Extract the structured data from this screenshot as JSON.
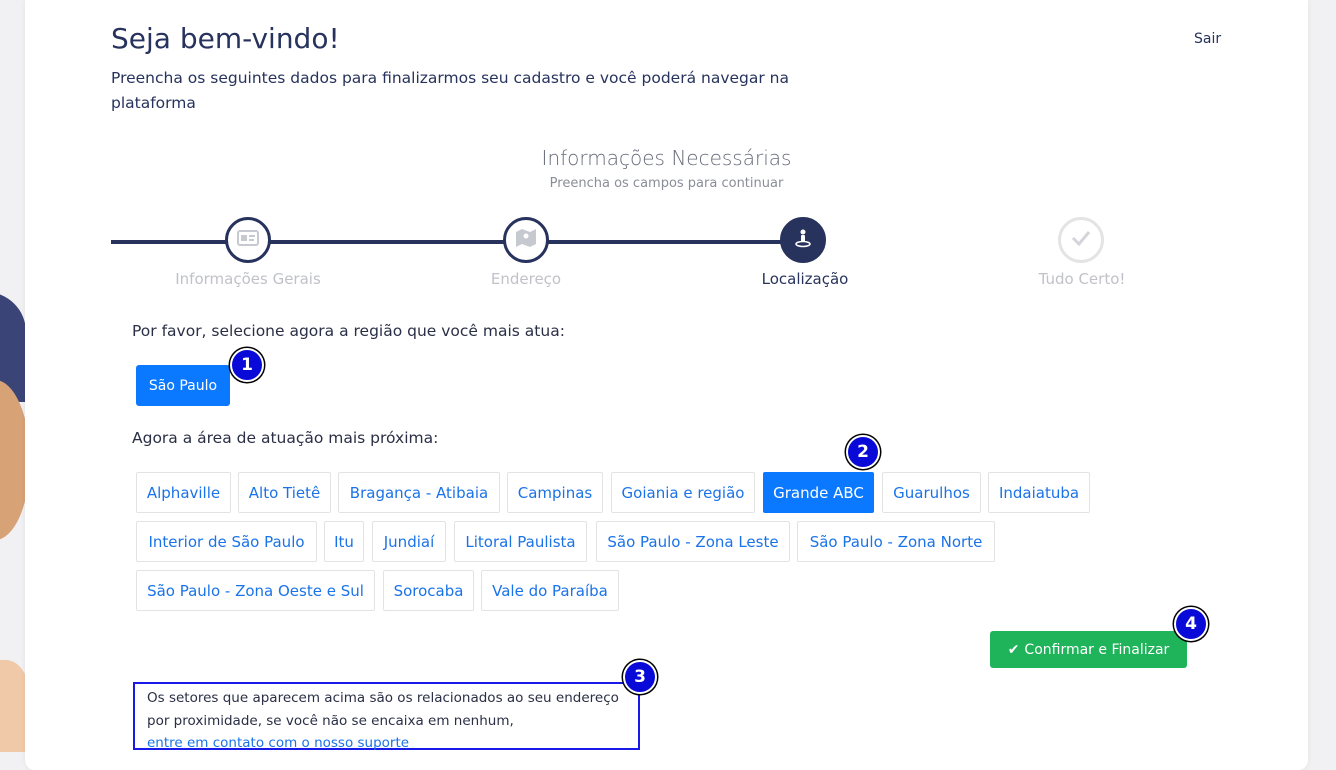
{
  "header": {
    "title": "Seja bem-vindo!",
    "subtitle": "Preencha os seguintes dados para finalizarmos seu cadastro e você poderá navegar na plataforma",
    "logout_label": "Sair"
  },
  "info": {
    "heading": "Informações Necessárias",
    "subheading": "Preencha os campos para continuar"
  },
  "steps": [
    {
      "label": "Informações Gerais",
      "icon": "id-card-icon",
      "state": "done"
    },
    {
      "label": "Endereço",
      "icon": "map-icon",
      "state": "done"
    },
    {
      "label": "Localização",
      "icon": "location-person-icon",
      "state": "active"
    },
    {
      "label": "Tudo Certo!",
      "icon": "check-icon",
      "state": "pending"
    }
  ],
  "region": {
    "question": "Por favor, selecione agora a região que você mais atua:",
    "options": [
      "São Paulo"
    ],
    "selected": "São Paulo"
  },
  "area": {
    "question": "Agora a área de atuação mais próxima:",
    "options": [
      "Alphaville",
      "Alto Tietê",
      "Bragança - Atibaia",
      "Campinas",
      "Goiania e região",
      "Grande ABC",
      "Guarulhos",
      "Indaiatuba",
      "Interior de São Paulo",
      "Itu",
      "Jundiaí",
      "Litoral Paulista",
      "São Paulo - Zona Leste",
      "São Paulo - Zona Norte",
      "São Paulo - Zona Oeste e Sul",
      "Sorocaba",
      "Vale do Paraíba"
    ],
    "selected": "Grande ABC"
  },
  "confirm_label": "Confirmar e Finalizar",
  "note": {
    "text": "Os setores que aparecem acima são os relacionados ao seu endereço por proximidade, se você não se encaixa em nenhum,",
    "link": "entre em contato com o nosso suporte"
  },
  "markers": [
    "1",
    "2",
    "3",
    "4"
  ],
  "colors": {
    "navy": "#27335d",
    "primary": "#0a79ff",
    "success": "#1fb35a",
    "marker": "#0a0ad8"
  }
}
